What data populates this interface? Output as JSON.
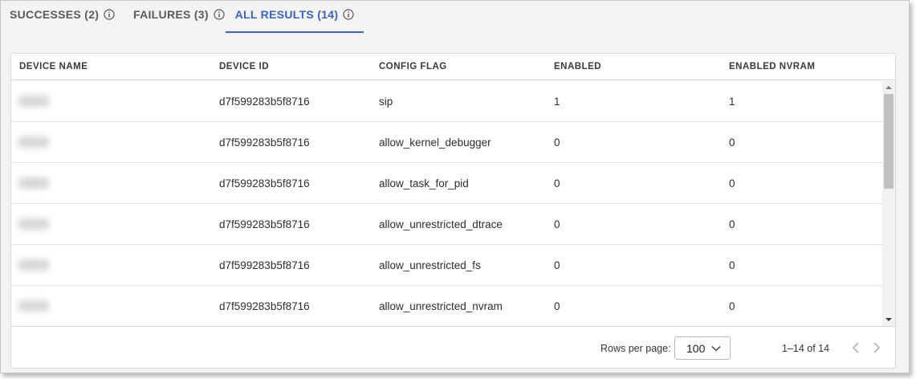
{
  "tabs": [
    {
      "label": "SUCCESSES (2)",
      "active": false
    },
    {
      "label": "FAILURES (3)",
      "active": false
    },
    {
      "label": "ALL RESULTS (14)",
      "active": true
    }
  ],
  "table": {
    "columns": [
      "DEVICE NAME",
      "DEVICE ID",
      "CONFIG FLAG",
      "ENABLED",
      "ENABLED NVRAM"
    ],
    "rows": [
      {
        "device_id": "d7f599283b5f8716",
        "config_flag": "sip",
        "enabled": "1",
        "enabled_nvram": "1"
      },
      {
        "device_id": "d7f599283b5f8716",
        "config_flag": "allow_kernel_debugger",
        "enabled": "0",
        "enabled_nvram": "0"
      },
      {
        "device_id": "d7f599283b5f8716",
        "config_flag": "allow_task_for_pid",
        "enabled": "0",
        "enabled_nvram": "0"
      },
      {
        "device_id": "d7f599283b5f8716",
        "config_flag": "allow_unrestricted_dtrace",
        "enabled": "0",
        "enabled_nvram": "0"
      },
      {
        "device_id": "d7f599283b5f8716",
        "config_flag": "allow_unrestricted_fs",
        "enabled": "0",
        "enabled_nvram": "0"
      },
      {
        "device_id": "d7f599283b5f8716",
        "config_flag": "allow_unrestricted_nvram",
        "enabled": "0",
        "enabled_nvram": "0"
      }
    ]
  },
  "pagination": {
    "rows_per_page_label": "Rows per page:",
    "rows_per_page_value": "100",
    "range": "1–14 of 14"
  },
  "colors": {
    "accent": "#3c63b5",
    "tab_inactive": "#5a5a5a"
  },
  "icons": [
    "info-icon",
    "chevron-down-icon",
    "chevron-left-icon",
    "chevron-right-icon",
    "scroll-up-icon",
    "scroll-down-icon"
  ]
}
